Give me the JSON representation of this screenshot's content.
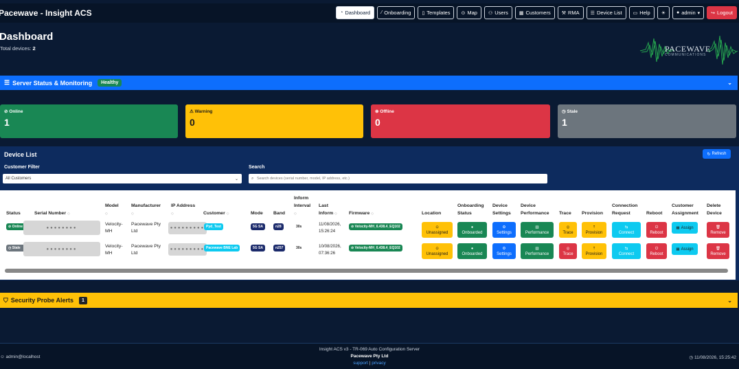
{
  "app": {
    "brand": "Pacewave - Insight ACS"
  },
  "nav": {
    "items": [
      {
        "label": "Dashboard",
        "icon": "dashboard-icon",
        "active": true
      },
      {
        "label": "Onboarding",
        "icon": "wand-icon"
      },
      {
        "label": "Templates",
        "icon": "file-icon"
      },
      {
        "label": "Map",
        "icon": "map-pin-icon"
      },
      {
        "label": "Users",
        "icon": "users-icon"
      },
      {
        "label": "Customers",
        "icon": "building-icon"
      },
      {
        "label": "RMA",
        "icon": "wrench-icon"
      },
      {
        "label": "Device List",
        "icon": "list-icon"
      },
      {
        "label": "Help",
        "icon": "book-icon"
      }
    ],
    "theme_icon": "sun-icon",
    "user_label": "admin",
    "logout_label": "Logout"
  },
  "header": {
    "title": "Dashboard",
    "total_label": "Total devices:",
    "total_value": "2",
    "logo_text": "PACEWAVE",
    "logo_sub": "COMMUNICATIONS"
  },
  "server_status": {
    "title": "Server Status & Monitoring",
    "badge": "Healthy",
    "color": "#0d6efd"
  },
  "stats": [
    {
      "label": "Online",
      "value": "1",
      "color": "#198754",
      "icon": "check-circle-icon"
    },
    {
      "label": "Warning",
      "value": "0",
      "color": "#ffc107",
      "icon": "warning-icon"
    },
    {
      "label": "Offline",
      "value": "0",
      "color": "#dc3545",
      "icon": "x-circle-icon"
    },
    {
      "label": "Stale",
      "value": "1",
      "color": "#6c757d",
      "icon": "clock-icon"
    }
  ],
  "device_list": {
    "title": "Device List",
    "refresh_label": "Refresh",
    "customer_filter_label": "Customer Filter",
    "customer_filter_value": "All Customers",
    "search_label": "Search",
    "search_placeholder": "Search devices (serial number, model, IP address, etc.)",
    "columns": {
      "status": "Status",
      "serial": "Serial Number",
      "model": "Model",
      "manufacturer": "Manufacturer",
      "ip": "IP Address",
      "customer": "Customer",
      "mode": "Mode",
      "band": "Band",
      "inform_interval_1": "Inform",
      "inform_interval_2": "Interval",
      "last_inform_1": "Last",
      "last_inform_2": "Inform",
      "firmware": "Firmware",
      "location": "Location",
      "onboarding_1": "Onboarding",
      "onboarding_2": "Status",
      "settings_1": "Device",
      "settings_2": "Settings",
      "performance_1": "Device",
      "performance_2": "Performance",
      "trace": "Trace",
      "provision": "Provision",
      "connection_1": "Connection",
      "connection_2": "Request",
      "reboot": "Reboot",
      "assignment_1": "Customer",
      "assignment_2": "Assignment",
      "delete_1": "Delete",
      "delete_2": "Device"
    },
    "rows": [
      {
        "status": "Online",
        "status_color": "#198754",
        "serial": "●●●●●●●●",
        "model_1": "Velocity-",
        "model_2": "MH",
        "manufacturer_1": "Pacewave Pty",
        "manufacturer_2": "Ltd",
        "ip": "●●●●●●●●●",
        "customer": "Pyd_Test",
        "mode": "5G SA",
        "band": "n28",
        "interval": "30s",
        "last_inform_1": "11/08/2026,",
        "last_inform_2": "15:26:24",
        "firmware": "Velocity-MH_6.438.4_EQ102",
        "location": "Unassigned",
        "onboarding": "Onboarded",
        "settings": "Settings",
        "performance": "Performance",
        "trace": "Trace",
        "trace_color": "#ffc107",
        "provision": "Provision",
        "connect": "Connect",
        "reboot": "Reboot",
        "assign": "Assign",
        "remove": "Remove"
      },
      {
        "status": "Stale",
        "status_color": "#6c757d",
        "serial": "●●●●●●●●",
        "model_1": "Velocity-",
        "model_2": "MH",
        "manufacturer_1": "Pacewave Pty",
        "manufacturer_2": "Ltd",
        "ip": "●●●●●●●●●",
        "customer": "Pacewave BNE Lab",
        "mode": "5G SA",
        "band": "n257",
        "interval": "30s",
        "last_inform_1": "10/08/2026,",
        "last_inform_2": "07:36:26",
        "firmware": "Velocity-MH_6.438.4_EQ102",
        "location": "Unassigned",
        "onboarding": "Onboarded",
        "settings": "Settings",
        "performance": "Performance",
        "trace": "Trace",
        "trace_color": "#dc3545",
        "provision": "Provision",
        "connect": "Connect",
        "reboot": "Reboot",
        "assign": "Assign",
        "remove": "Remove"
      }
    ]
  },
  "security": {
    "title": "Security Probe Alerts",
    "count": "1"
  },
  "footer": {
    "left": "admin@localhost",
    "line1": "Insight ACS v3 - TR-069 Auto Configuration Server",
    "line2": "Pacewave Pty Ltd",
    "link_support": "support",
    "separator": "|",
    "link_privacy": "privacy",
    "right": "11/08/2026, 15:25:42"
  }
}
